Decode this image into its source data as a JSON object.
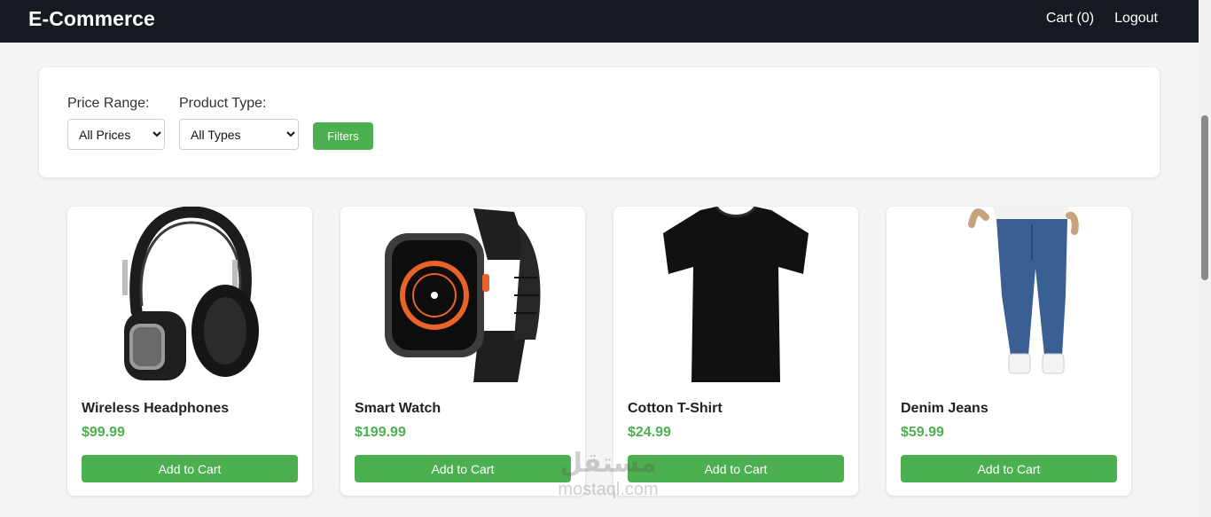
{
  "header": {
    "brand": "E-Commerce",
    "cart_label": "Cart (0)",
    "logout_label": "Logout"
  },
  "filters": {
    "price_label": "Price Range:",
    "price_selected": "All Prices",
    "type_label": "Product Type:",
    "type_selected": "All Types",
    "button_label": "Filters"
  },
  "products": [
    {
      "name": "Wireless Headphones",
      "price": "$99.99",
      "button": "Add to Cart",
      "image_icon": "headphones-image"
    },
    {
      "name": "Smart Watch",
      "price": "$199.99",
      "button": "Add to Cart",
      "image_icon": "smartwatch-image"
    },
    {
      "name": "Cotton T-Shirt",
      "price": "$24.99",
      "button": "Add to Cart",
      "image_icon": "tshirt-image"
    },
    {
      "name": "Denim Jeans",
      "price": "$59.99",
      "button": "Add to Cart",
      "image_icon": "jeans-image"
    }
  ],
  "watermark": {
    "logo": "مستقل",
    "url": "mostaql.com"
  },
  "colors": {
    "header_bg": "#141a20",
    "accent_green": "#4caf50",
    "page_bg": "#f5f5f5"
  }
}
